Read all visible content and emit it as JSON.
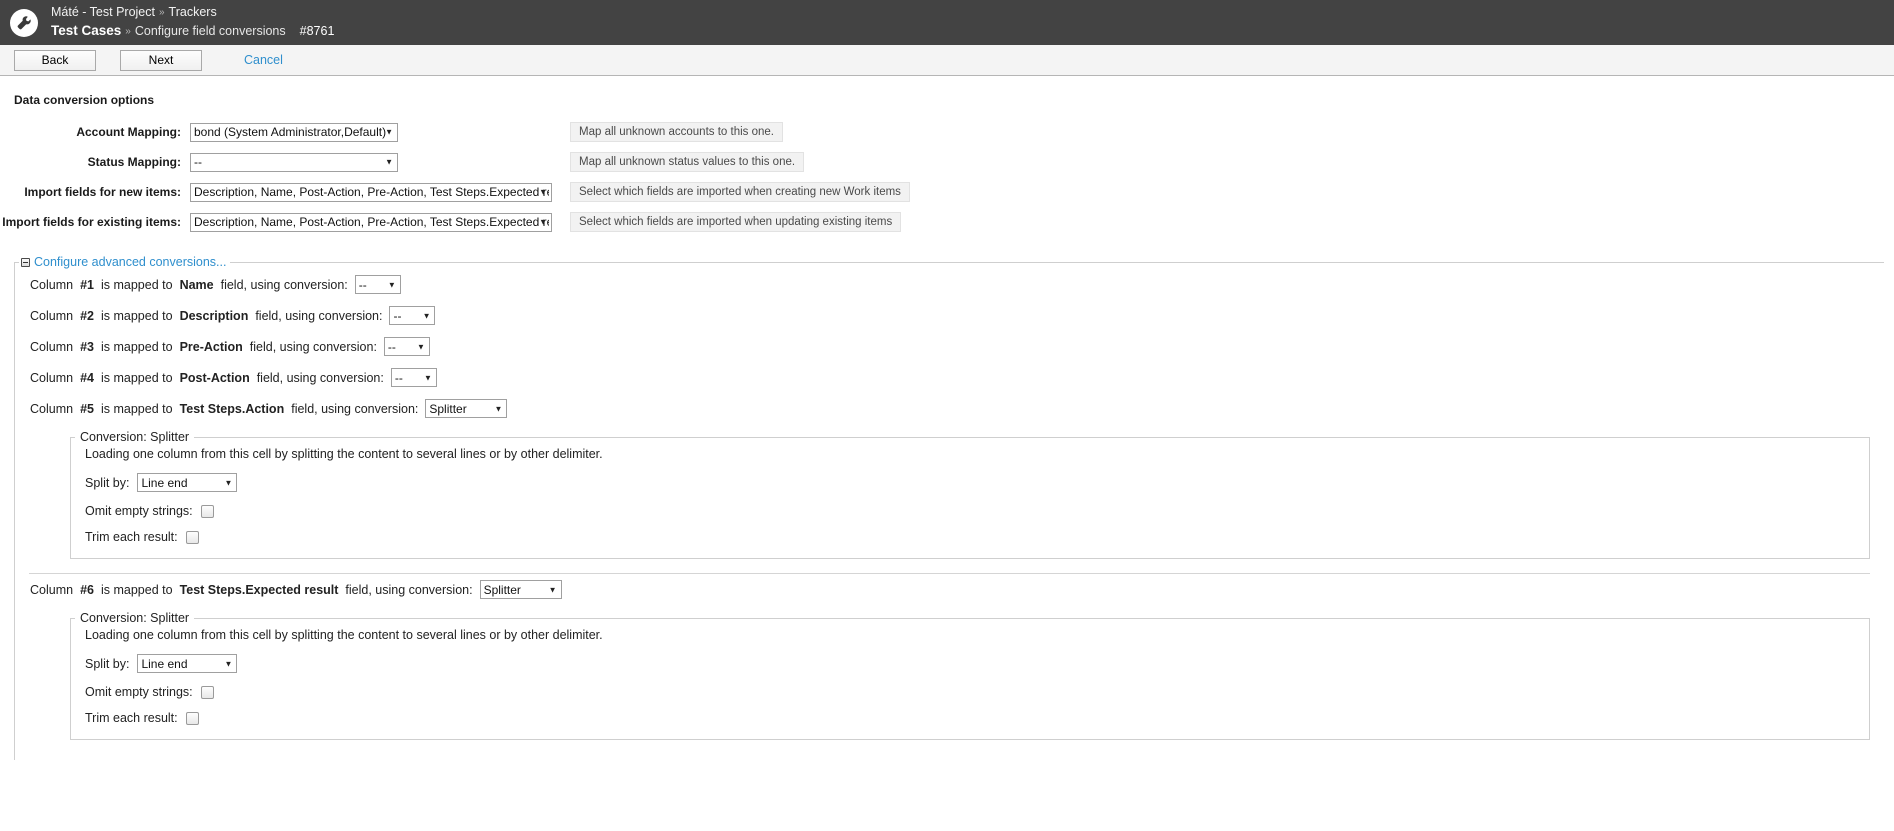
{
  "header": {
    "logo_icon": "wrench-circle-icon",
    "breadcrumb_top": {
      "project": "Máté - Test Project",
      "separator": "»",
      "section": "Trackers"
    },
    "breadcrumb_bottom": {
      "tracker": "Test Cases",
      "separator": "»",
      "page": "Configure field conversions",
      "item_id": "#8761"
    }
  },
  "toolbar": {
    "back_label": "Back",
    "next_label": "Next",
    "cancel_label": "Cancel",
    "cancel_color": "#2f8fcd"
  },
  "main": {
    "section_title": "Data conversion options",
    "mappings": [
      {
        "label": "Account Mapping:",
        "value": "bond (System Administrator,Default)",
        "hint": "Map all unknown accounts to this one."
      },
      {
        "label": "Status Mapping:",
        "value": "--",
        "hint": "Map all unknown status values to this one."
      },
      {
        "label": "Import fields for new items:",
        "value": "Description, Name, Post-Action, Pre-Action, Test Steps.Expected result",
        "hint": "Select which fields are imported when creating new Work items"
      },
      {
        "label": "Import fields for existing items:",
        "value": "Description, Name, Post-Action, Pre-Action, Test Steps.Expected result",
        "hint": "Select which fields are imported when updating existing items"
      }
    ],
    "advanced": {
      "legend": "Configure advanced conversions...",
      "toggle_icon": "collapse-minus-icon",
      "columns": [
        {
          "prefix": "Column",
          "number": "#1",
          "mid": "is mapped to",
          "field": "Name",
          "suffix": "field, using conversion:",
          "conversion": "--",
          "splitter": null
        },
        {
          "prefix": "Column",
          "number": "#2",
          "mid": "is mapped to",
          "field": "Description",
          "suffix": "field, using conversion:",
          "conversion": "--",
          "splitter": null
        },
        {
          "prefix": "Column",
          "number": "#3",
          "mid": "is mapped to",
          "field": "Pre-Action",
          "suffix": "field, using conversion:",
          "conversion": "--",
          "splitter": null
        },
        {
          "prefix": "Column",
          "number": "#4",
          "mid": "is mapped to",
          "field": "Post-Action",
          "suffix": "field, using conversion:",
          "conversion": "--",
          "splitter": null
        },
        {
          "prefix": "Column",
          "number": "#5",
          "mid": "is mapped to",
          "field": "Test Steps.Action",
          "suffix": "field, using conversion:",
          "conversion": "Splitter",
          "splitter": {
            "legend": "Conversion: Splitter",
            "description": "Loading one column from this cell by splitting the content to several lines or by other delimiter.",
            "split_by_label": "Split by:",
            "split_by_value": "Line end",
            "omit_label": "Omit empty strings:",
            "omit_checked": false,
            "trim_label": "Trim each result:",
            "trim_checked": false
          }
        },
        {
          "prefix": "Column",
          "number": "#6",
          "mid": "is mapped to",
          "field": "Test Steps.Expected result",
          "suffix": "field, using conversion:",
          "conversion": "Splitter",
          "splitter": {
            "legend": "Conversion: Splitter",
            "description": "Loading one column from this cell by splitting the content to several lines or by other delimiter.",
            "split_by_label": "Split by:",
            "split_by_value": "Line end",
            "omit_label": "Omit empty strings:",
            "omit_checked": false,
            "trim_label": "Trim each result:",
            "trim_checked": false
          }
        }
      ]
    }
  }
}
